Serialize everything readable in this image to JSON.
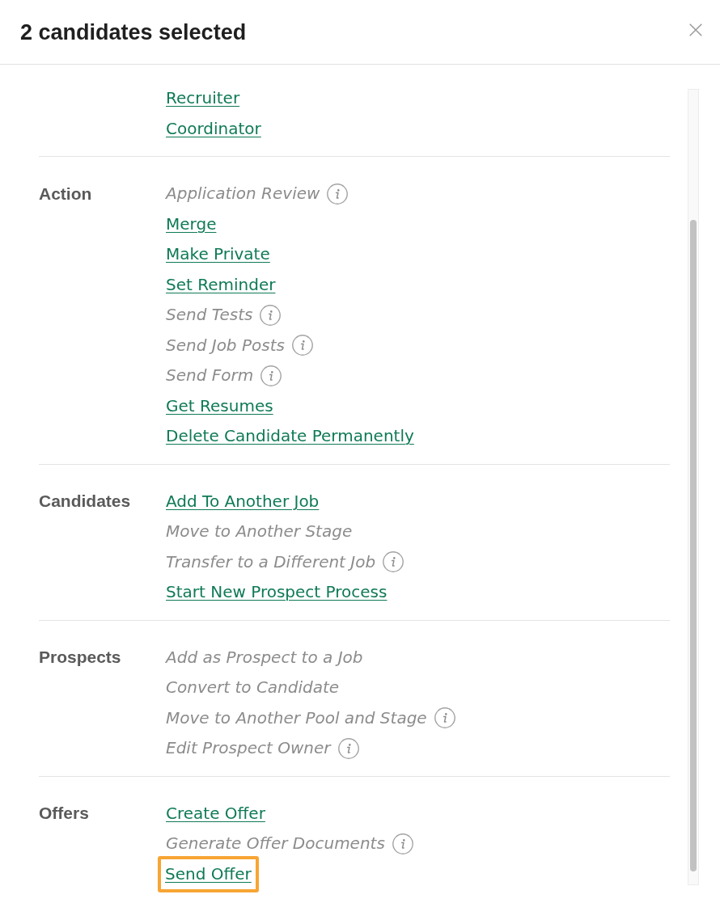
{
  "dialog": {
    "title": "2 candidates selected"
  },
  "sections": [
    {
      "items": [
        {
          "label": "Recruiter",
          "disabled": false,
          "info": false,
          "highlighted": false
        },
        {
          "label": "Coordinator",
          "disabled": false,
          "info": false,
          "highlighted": false
        }
      ]
    },
    {
      "label": "Action",
      "items": [
        {
          "label": "Application Review",
          "disabled": true,
          "info": true,
          "highlighted": false
        },
        {
          "label": "Merge",
          "disabled": false,
          "info": false,
          "highlighted": false
        },
        {
          "label": "Make Private",
          "disabled": false,
          "info": false,
          "highlighted": false
        },
        {
          "label": "Set Reminder",
          "disabled": false,
          "info": false,
          "highlighted": false
        },
        {
          "label": "Send Tests",
          "disabled": true,
          "info": true,
          "highlighted": false
        },
        {
          "label": "Send Job Posts",
          "disabled": true,
          "info": true,
          "highlighted": false
        },
        {
          "label": "Send Form",
          "disabled": true,
          "info": true,
          "highlighted": false
        },
        {
          "label": "Get Resumes",
          "disabled": false,
          "info": false,
          "highlighted": false
        },
        {
          "label": "Delete Candidate Permanently",
          "disabled": false,
          "info": false,
          "highlighted": false
        }
      ]
    },
    {
      "label": "Candidates",
      "items": [
        {
          "label": "Add To Another Job",
          "disabled": false,
          "info": false,
          "highlighted": false
        },
        {
          "label": "Move to Another Stage",
          "disabled": true,
          "info": false,
          "highlighted": false
        },
        {
          "label": "Transfer to a Different Job",
          "disabled": true,
          "info": true,
          "highlighted": false
        },
        {
          "label": "Start New Prospect Process",
          "disabled": false,
          "info": false,
          "highlighted": false
        }
      ]
    },
    {
      "label": "Prospects",
      "items": [
        {
          "label": "Add as Prospect to a Job",
          "disabled": true,
          "info": false,
          "highlighted": false
        },
        {
          "label": "Convert to Candidate",
          "disabled": true,
          "info": false,
          "highlighted": false
        },
        {
          "label": "Move to Another Pool and Stage",
          "disabled": true,
          "info": true,
          "highlighted": false
        },
        {
          "label": "Edit Prospect Owner",
          "disabled": true,
          "info": true,
          "highlighted": false
        }
      ]
    },
    {
      "label": "Offers",
      "items": [
        {
          "label": "Create Offer",
          "disabled": false,
          "info": false,
          "highlighted": false
        },
        {
          "label": "Generate Offer Documents",
          "disabled": true,
          "info": true,
          "highlighted": false
        },
        {
          "label": "Send Offer",
          "disabled": false,
          "info": false,
          "highlighted": true
        }
      ]
    }
  ]
}
